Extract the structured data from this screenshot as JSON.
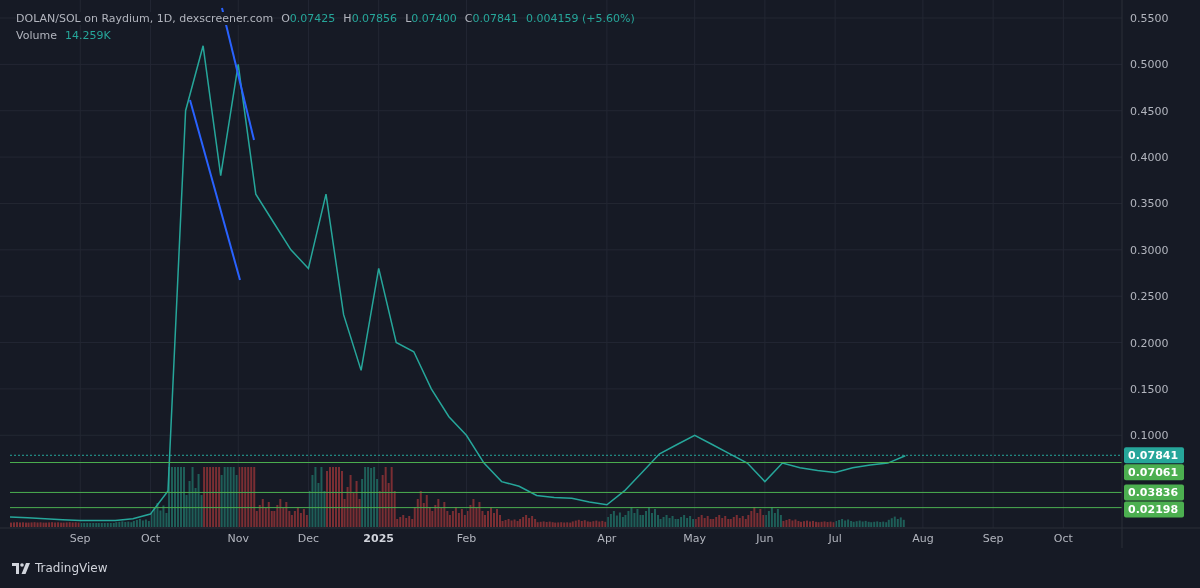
{
  "legend": {
    "symbol": "DOLAN/SOL on Raydium, 1D, dexscreener.com",
    "ohlc": [
      {
        "key": "O",
        "value": "0.07425"
      },
      {
        "key": "H",
        "value": "0.07856"
      },
      {
        "key": "L",
        "value": "0.07400"
      },
      {
        "key": "C",
        "value": "0.07841"
      }
    ],
    "change": "0.004159 (+5.60%)",
    "volume_label": "Volume",
    "volume": "14.259K"
  },
  "price_labels": [
    {
      "kind": "last",
      "value": "0.07841",
      "color": "#26a69a"
    },
    {
      "kind": "level",
      "value": "0.07061",
      "color": "#4caf50"
    },
    {
      "kind": "level",
      "value": "0.03836",
      "color": "#4caf50"
    },
    {
      "kind": "level",
      "value": "0.02198",
      "color": "#4caf50"
    }
  ],
  "chart_data": {
    "type": "line",
    "grid": true,
    "ylim": [
      0,
      0.55
    ],
    "categories": [
      null,
      null,
      null,
      null,
      "Sep",
      null,
      null,
      null,
      "Oct",
      null,
      null,
      null,
      null,
      "Nov",
      null,
      null,
      null,
      "Dec",
      null,
      null,
      null,
      "2025",
      null,
      null,
      null,
      null,
      "Feb",
      null,
      null,
      null,
      null,
      null,
      null,
      null,
      "Apr",
      null,
      null,
      null,
      null,
      "May",
      null,
      null,
      null,
      "Jun",
      null,
      null,
      null,
      "Jul",
      null,
      null,
      null,
      null,
      "Aug",
      null,
      null,
      null,
      "Sep",
      null,
      null,
      null,
      "Oct",
      null,
      null,
      null
    ],
    "yticks": [
      {
        "value": 0.1,
        "label": "0.1000"
      },
      {
        "value": 0.15,
        "label": "0.1500"
      },
      {
        "value": 0.2,
        "label": "0.2000"
      },
      {
        "value": 0.25,
        "label": "0.2500"
      },
      {
        "value": 0.3,
        "label": "0.3000"
      },
      {
        "value": 0.35,
        "label": "0.3500"
      },
      {
        "value": 0.4,
        "label": "0.4000"
      },
      {
        "value": 0.45,
        "label": "0.4500"
      },
      {
        "value": 0.5,
        "label": "0.5000"
      },
      {
        "value": 0.55,
        "label": "0.5500"
      }
    ],
    "series": [
      {
        "color": "#26a69a",
        "values": [
          0.012,
          0.011,
          0.01,
          0.009,
          0.008,
          0.008,
          0.008,
          0.01,
          0.015,
          0.04,
          0.45,
          0.52,
          0.38,
          0.5,
          0.36,
          0.33,
          0.3,
          0.28,
          0.36,
          0.23,
          0.17,
          0.28,
          0.2,
          0.19,
          0.15,
          0.12,
          0.1,
          0.07,
          0.05,
          0.045,
          0.035,
          0.033,
          0.032,
          0.028,
          0.025,
          0.04,
          0.06,
          0.08,
          0.09,
          0.1,
          0.09,
          0.08,
          0.07,
          0.05,
          0.07,
          0.065,
          0.062,
          0.06,
          0.065,
          0.068,
          0.07,
          0.078,
          null,
          null,
          null,
          null,
          null,
          null,
          null,
          null,
          null,
          null,
          null,
          null
        ]
      }
    ]
  },
  "footer": {
    "brand": "TradingView"
  }
}
